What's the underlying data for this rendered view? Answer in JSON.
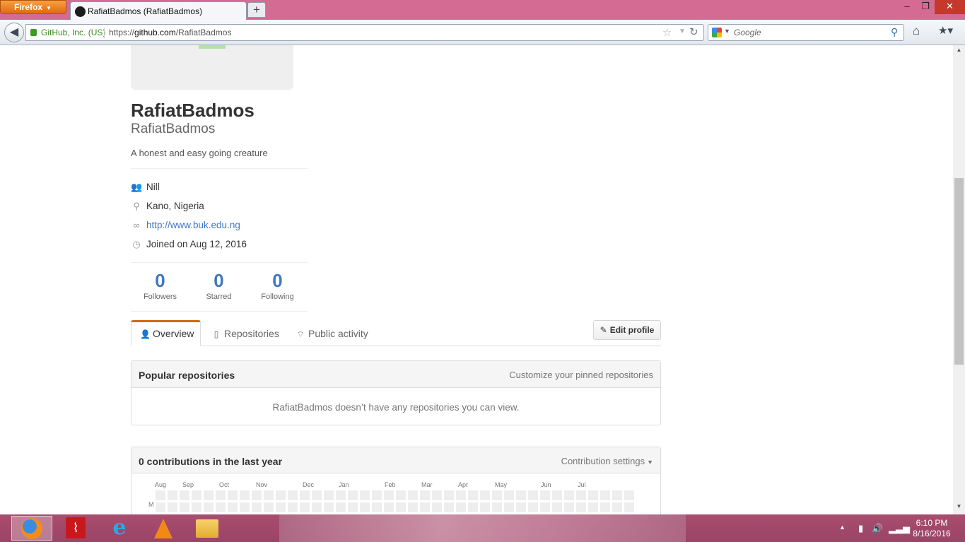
{
  "browser": {
    "menu_label": "Firefox",
    "tab_title": "RafiatBadmos (RafiatBadmos)",
    "identity": "GitHub, Inc. (US)",
    "url_prefix": "https://",
    "url_domain": "github.com",
    "url_path": "/RafiatBadmos",
    "search_placeholder": "Google"
  },
  "profile": {
    "fullname": "RafiatBadmos",
    "username": "RafiatBadmos",
    "bio": "A honest and easy going creature",
    "details": {
      "organization": "Nill",
      "location": "Kano, Nigeria",
      "website": "http://www.buk.edu.ng",
      "joined": "Joined on Aug 12, 2016"
    },
    "stats": [
      {
        "value": "0",
        "label": "Followers"
      },
      {
        "value": "0",
        "label": "Starred"
      },
      {
        "value": "0",
        "label": "Following"
      }
    ]
  },
  "tabs": {
    "overview": "Overview",
    "repositories": "Repositories",
    "activity": "Public activity",
    "edit_profile": "Edit profile"
  },
  "popular": {
    "title": "Popular repositories",
    "customize": "Customize your pinned repositories",
    "empty": "RafiatBadmos doesn’t have any repositories you can view."
  },
  "contributions": {
    "title": "0 contributions in the last year",
    "settings": "Contribution settings",
    "months": [
      "Aug",
      "Sep",
      "Oct",
      "Nov",
      "Dec",
      "Jan",
      "Feb",
      "Mar",
      "Apr",
      "May",
      "Jun",
      "Jul"
    ],
    "day_label": "M"
  },
  "taskbar": {
    "apps": [
      "firefox-icon",
      "acrobat-icon",
      "internet-explorer-icon",
      "vlc-icon",
      "file-explorer-icon"
    ],
    "time": "6:10 PM",
    "date": "8/16/2016"
  }
}
